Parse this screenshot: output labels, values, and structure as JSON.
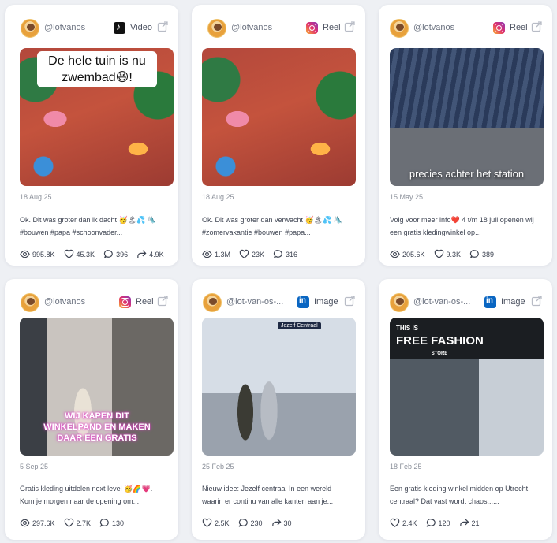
{
  "cards": [
    {
      "handle": "@lotvanos",
      "platform": "tiktok",
      "post_type": "Video",
      "overlay": "De hele tuin is nu zwembad😆!",
      "date": "18 Aug 25",
      "caption": "Ok. Dit was groter dan ik dacht 🥳🏝💦 🛝#bouwen #papa #schoonvader...",
      "views": "995.8K",
      "likes": "45.3K",
      "comments": "396",
      "shares": "4.9K"
    },
    {
      "handle": "@lotvanos",
      "platform": "instagram",
      "post_type": "Reel",
      "date": "18 Aug 25",
      "caption": "Ok. Dit was groter dan verwacht 🥳🏝💦 🛝#zomervakantie #bouwen #papa...",
      "views": "1.3M",
      "likes": "23K",
      "comments": "316"
    },
    {
      "handle": "@lotvanos",
      "platform": "instagram",
      "post_type": "Reel",
      "overlay": "precies achter het station",
      "date": "15 May 25",
      "caption": "Volg voor meer info❤️ 4 t/m 18 juli openen wij een gratis kledingwinkel op...",
      "views": "205.6K",
      "likes": "9.3K",
      "comments": "389"
    },
    {
      "handle": "@lotvanos",
      "platform": "instagram",
      "post_type": "Reel",
      "overlay": "WIJ KAPEN DIT WINKELPAND EN MAKEN DAAR EEN GRATIS",
      "date": "5 Sep 25",
      "caption": "Gratis kleding uitdelen next level 🥳🌈💗. Kom je morgen naar de opening om...",
      "views": "297.6K",
      "likes": "2.7K",
      "comments": "130"
    },
    {
      "handle": "@lot-van-os-...",
      "platform": "linkedin",
      "post_type": "Image",
      "overlay": "Jezelf Centraal",
      "date": "25 Feb 25",
      "caption": "Nieuw idee: Jezelf centraal In een wereld waarin er continu van alle kanten aan je...",
      "likes": "2.5K",
      "comments": "230",
      "shares": "30"
    },
    {
      "handle": "@lot-van-os-...",
      "platform": "linkedin",
      "post_type": "Image",
      "overlay_top": "THIS IS",
      "overlay": "FREE FASHION",
      "overlay_sub": "STORE",
      "date": "18 Feb 25",
      "caption": "Een gratis kleding winkel midden op Utrecht centraal? Dat vast wordt chaos......",
      "likes": "2.4K",
      "comments": "120",
      "shares": "21"
    }
  ]
}
